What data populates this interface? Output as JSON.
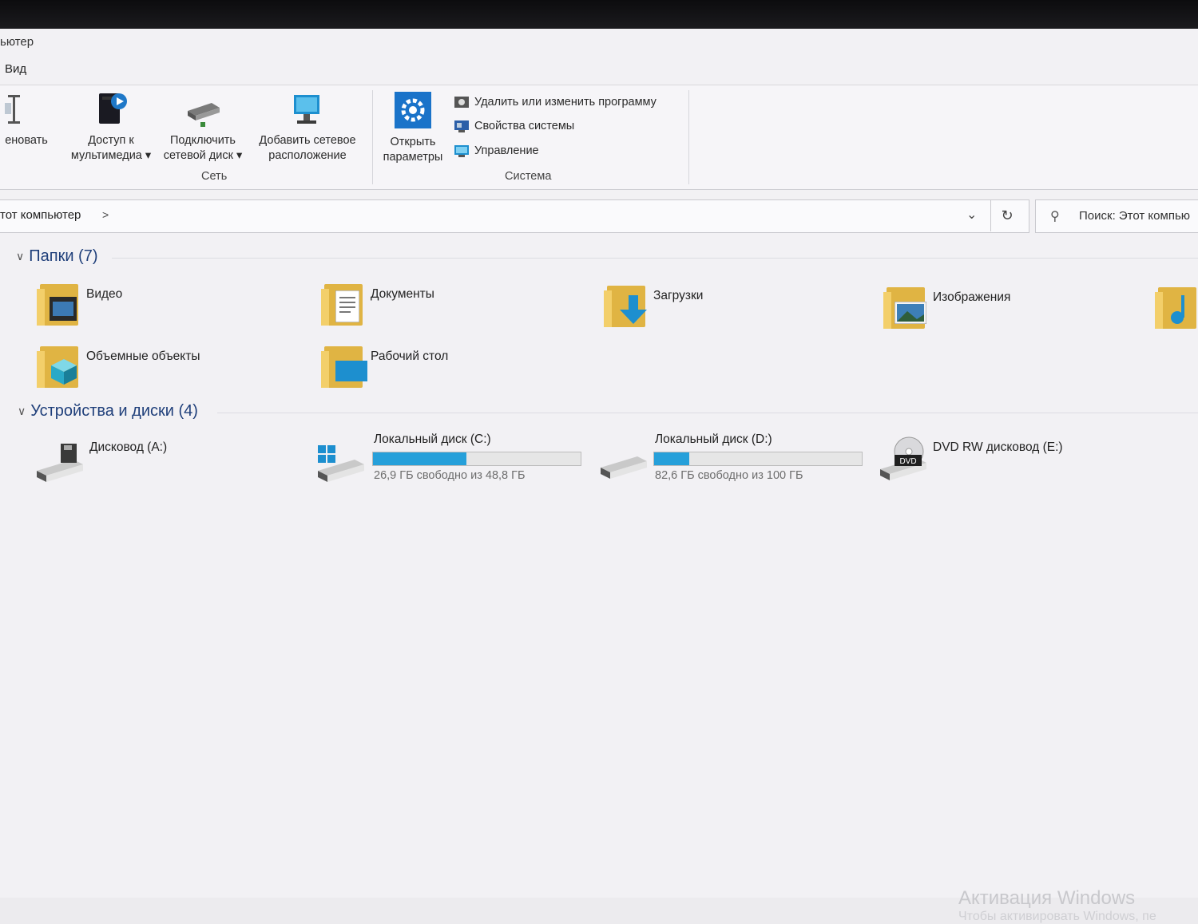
{
  "window": {
    "title_fragment": "ьютер",
    "menu_tab": "Вид"
  },
  "ribbon": {
    "buttons": [
      {
        "label": "еновать"
      },
      {
        "label": "Доступ к мультимедиа ▾"
      },
      {
        "label": "Подключить сетевой диск ▾"
      },
      {
        "label": "Добавить сетевое расположение"
      },
      {
        "label": "Открыть параметры"
      }
    ],
    "system_commands": [
      {
        "label": "Удалить или изменить программу",
        "icon": "uninstall-icon"
      },
      {
        "label": "Свойства системы",
        "icon": "system-properties-icon"
      },
      {
        "label": "Управление",
        "icon": "management-icon"
      }
    ],
    "groups": {
      "network": "Сеть",
      "system": "Система"
    }
  },
  "address_bar": {
    "path": "тот компьютер",
    "chevron": ">"
  },
  "search": {
    "placeholder": "Поиск: Этот компью"
  },
  "sections": {
    "folders": {
      "title": "Папки (7)"
    },
    "devices": {
      "title": "Устройства и диски (4)"
    }
  },
  "folders": [
    {
      "label": "Видео",
      "overlay": "video-icon"
    },
    {
      "label": "Документы",
      "overlay": "document-icon"
    },
    {
      "label": "Загрузки",
      "overlay": "download-arrow-icon"
    },
    {
      "label": "Изображения",
      "overlay": "image-icon"
    },
    {
      "label": "Объемные объекты",
      "overlay": "cube-icon"
    },
    {
      "label": "Рабочий стол",
      "overlay": "desktop-icon"
    }
  ],
  "drives": [
    {
      "label": "Дисковод (A:)",
      "icon": "floppy-drive-icon"
    },
    {
      "label": "Локальный диск (C:)",
      "free_text": "26,9 ГБ свободно из 48,8 ГБ",
      "used_fraction": 0.45,
      "icon": "windows-drive-icon"
    },
    {
      "label": "Локальный диск (D:)",
      "free_text": "82,6 ГБ свободно из 100 ГБ",
      "used_fraction": 0.17,
      "icon": "hard-drive-icon"
    },
    {
      "label": "DVD RW дисковод (E:)",
      "icon": "dvd-drive-icon",
      "badge": "DVD"
    }
  ],
  "watermark": {
    "line1": "Активация Windows",
    "line2": "Чтобы активировать Windows, пе"
  },
  "colors": {
    "progress_fill": "#26a0da",
    "section_heading": "#1f3f7a",
    "folder": "#e0b443"
  }
}
